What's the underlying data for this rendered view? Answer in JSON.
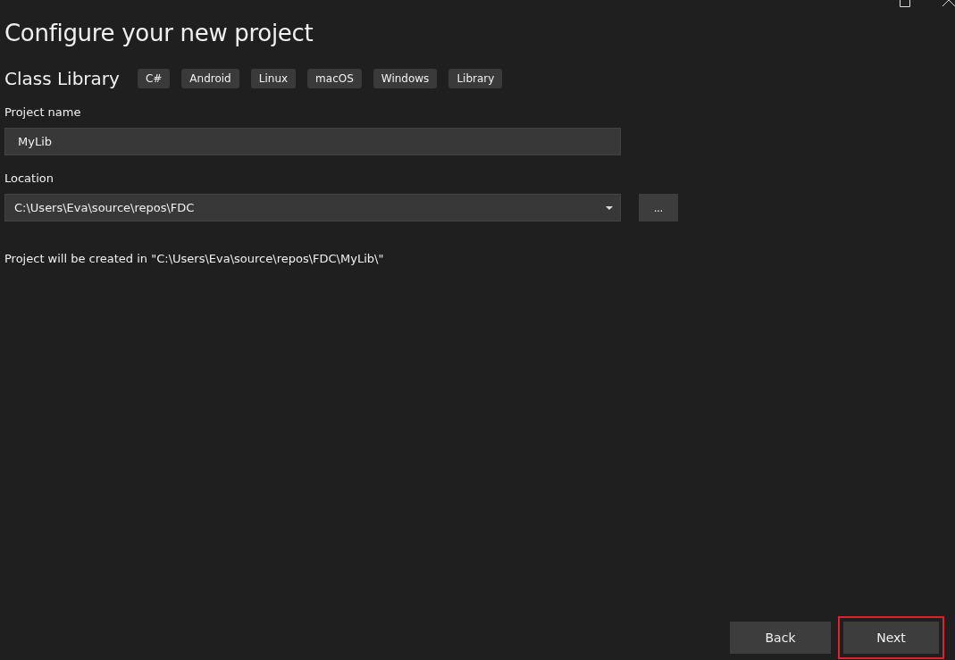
{
  "title": "Configure your new project",
  "template": {
    "name": "Class Library",
    "tags": [
      "C#",
      "Android",
      "Linux",
      "macOS",
      "Windows",
      "Library"
    ]
  },
  "project_name": {
    "label": "Project name",
    "value": "MyLib"
  },
  "location": {
    "label": "Location",
    "value": "C:\\Users\\Eva\\source\\repos\\FDC",
    "browse": "..."
  },
  "info": "Project will be created in \"C:\\Users\\Eva\\source\\repos\\FDC\\MyLib\\\"",
  "buttons": [
    {
      "label": "Back",
      "highlighted": false
    },
    {
      "label": "Next",
      "highlighted": true
    }
  ]
}
